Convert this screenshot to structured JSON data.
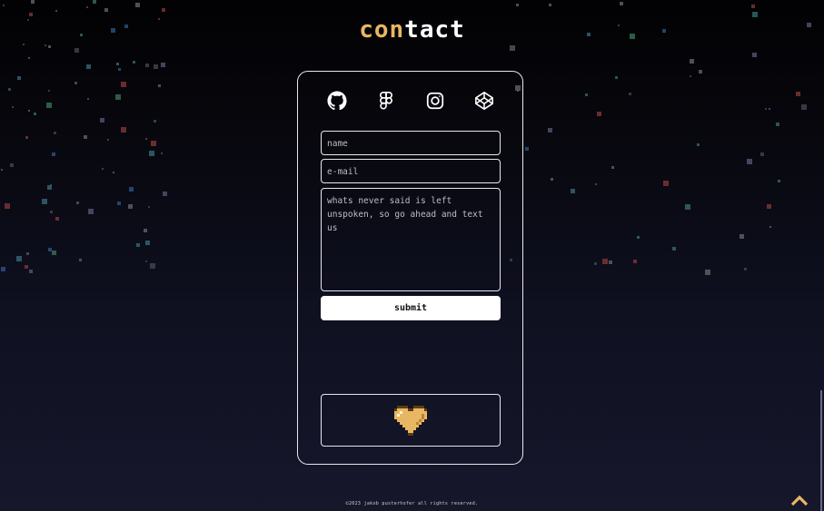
{
  "title": {
    "accent": "con",
    "rest": "tact"
  },
  "socials": [
    {
      "name": "github"
    },
    {
      "name": "figma"
    },
    {
      "name": "instagram"
    },
    {
      "name": "codepen"
    }
  ],
  "form": {
    "name_placeholder": "name",
    "email_placeholder": "e-mail",
    "message_placeholder": "whats never said is left unspoken, so go ahead and text us",
    "submit_label": "submit"
  },
  "heart_icon": "pixel-heart-icon",
  "footer": {
    "text": "©2023 jakob pusterhofer all rights reserved."
  },
  "scroll_top_icon": "chevron-up-icon",
  "colors": {
    "accent": "#e8b763",
    "background_top": "#020204",
    "background_bottom": "#16172b",
    "card_border": "#e8e8ee"
  }
}
